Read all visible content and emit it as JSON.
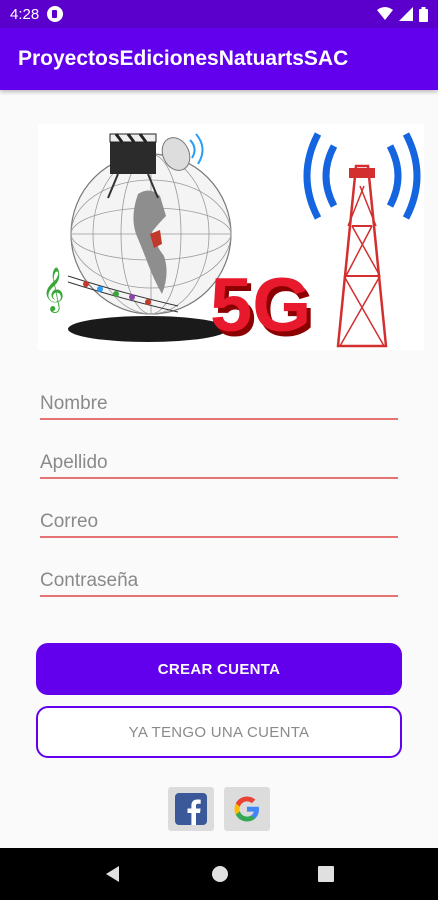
{
  "status_bar": {
    "time": "4:28"
  },
  "app_bar": {
    "title": "ProyectosEdicionesNatuartsSAC"
  },
  "banner": {
    "badge_text": "5G"
  },
  "form": {
    "nombre_placeholder": "Nombre",
    "apellido_placeholder": "Apellido",
    "correo_placeholder": "Correo",
    "contrasena_placeholder": "Contraseña"
  },
  "buttons": {
    "create_account": "CREAR CUENTA",
    "have_account": "YA TENGO UNA CUENTA"
  },
  "colors": {
    "primary": "#6200ee",
    "status_bar": "#5b00cc",
    "field_underline": "#e57373",
    "facebook": "#3b5998"
  },
  "icons": {
    "social": [
      "facebook-icon",
      "google-icon"
    ],
    "nav": [
      "back-icon",
      "home-icon",
      "recents-icon"
    ]
  }
}
